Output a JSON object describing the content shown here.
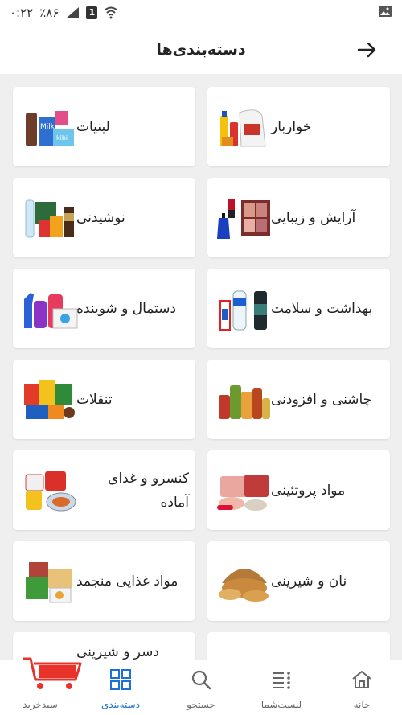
{
  "status_bar": {
    "time": "۰:۲۲",
    "battery": "٪۸۶",
    "sim": "1"
  },
  "header": {
    "title": "دسته‌بندی‌ها"
  },
  "categories": [
    {
      "label": "خواربار",
      "icon": "groceries-image"
    },
    {
      "label": "لبنیات",
      "icon": "dairy-image"
    },
    {
      "label": "آرایش و زیبایی",
      "icon": "cosmetics-image"
    },
    {
      "label": "نوشیدنی",
      "icon": "beverages-image"
    },
    {
      "label": "بهداشت و سلامت",
      "icon": "hygiene-image"
    },
    {
      "label": "دستمال و شوینده",
      "icon": "tissue-detergent-image"
    },
    {
      "label": "چاشنی و افزودنی",
      "icon": "condiments-image"
    },
    {
      "label": "تنقلات",
      "icon": "snacks-image"
    },
    {
      "label": "مواد پروتئینی",
      "icon": "protein-image"
    },
    {
      "label": "کنسرو و غذای آماده",
      "icon": "canned-food-image"
    },
    {
      "label": "نان و شیرینی",
      "icon": "bread-pastry-image"
    },
    {
      "label": "مواد غذایی منجمد",
      "icon": "frozen-food-image"
    },
    {
      "label": "",
      "icon": "more-category-image"
    },
    {
      "label": "دسر و شیرینی",
      "icon": "dessert-image"
    }
  ],
  "bottom_nav": {
    "items": [
      {
        "label": "خانه",
        "icon": "home-icon",
        "active": false
      },
      {
        "label": "لیست‌شما",
        "icon": "list-icon",
        "active": false
      },
      {
        "label": "جستجو",
        "icon": "search-icon",
        "active": false
      },
      {
        "label": "دسته‌بندی",
        "icon": "grid-icon",
        "active": true
      },
      {
        "label": "سبدخرید",
        "icon": "cart-icon",
        "active": false
      }
    ]
  },
  "colors": {
    "accent": "#1e6fd9",
    "background": "#efefef",
    "card": "#ffffff",
    "cart_logo": "#e8332a"
  }
}
